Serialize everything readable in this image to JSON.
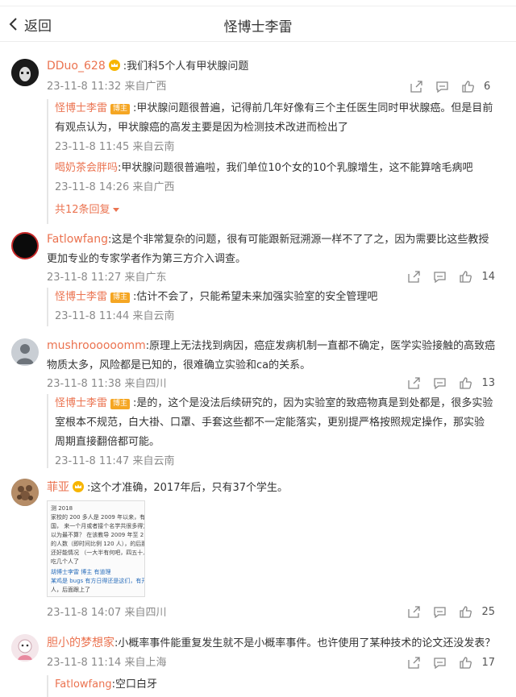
{
  "header": {
    "back_label": "返回",
    "title": "怪博士李雷"
  },
  "comments": [
    {
      "user": "DDuo_628",
      "text": ":我们科5个人有甲状腺问题",
      "meta": "23-11-8 11:32 来自广西",
      "likes": "6",
      "replies": [
        {
          "user": "怪博士李雷",
          "badge": "博主",
          "text": ":甲状腺问题很普遍，记得前几年好像有三个主任医生同时甲状腺癌。但是目前",
          "text2": "有观点认为，甲状腺癌的高发主要是因为检测技术改进而检出了",
          "meta": "23-11-8 11:45 来自云南"
        },
        {
          "user": "喝奶茶会胖吗",
          "text": ":甲状腺问题很普遍啦，我们单位10个女的10个乳腺增生，这不能算啥毛病吧",
          "meta": "23-11-8 14:26 来自广西"
        }
      ],
      "more_replies": "共12条回复"
    },
    {
      "user": "Fatlowfang",
      "text": ":这是个非常复杂的问题，很有可能跟新冠溯源一样不了了之，因为需要比这些教授",
      "text2": "更加专业的专家学者作为第三方介入调查。",
      "meta": "23-11-8 11:27 来自广东",
      "likes": "14",
      "replies": [
        {
          "user": "怪博士李雷",
          "badge": "博主",
          "text": ":估计不会了，只能希望未来加强实验室的安全管理吧",
          "meta": "23-11-8 11:44 来自云南"
        }
      ]
    },
    {
      "user": "mushroooooomm",
      "text": ":原理上无法找到病因，癌症发病机制一直都不确定，医学实验接触的高致癌",
      "text2": "物质太多，风险都是已知的，很难确立实验和ca的关系。",
      "meta": "23-11-8 11:38 来自四川",
      "likes": "13",
      "replies": [
        {
          "user": "怪博士李雷",
          "badge": "博主",
          "text": ":是的，这个是没法后续研究的，因为实验室的致癌物真是到处都是，很多实验",
          "text2": "室根本不规范，白大褂、口罩、手套这些都不一定能落实，更别提严格按照规定操作，那实验",
          "text3": "周期直接翻倍都可能。",
          "meta": "23-11-8 11:47 来自云南"
        }
      ]
    },
    {
      "user": "菲亚",
      "text": ":这个才准确，2017年后，只有37个学生。",
      "image_lines": [
        "测 2018",
        "家校的 200 多人是 2009 年以来，有且仅",
        "国， 来一个月或者接个名学共很多得方不简",
        "以为最不算？ 在该教导 2009 年至 2",
        "的人数（即时间比例 120 人），的后那段",
        "还好能情况 （一大半有何吧，四五十人）",
        "吃几个人了",
        "胡博士李雷 博主 有道理",
        "某鸡是 bugs 有方日得还是这们，有开化以后",
        "人，后面跟上了"
      ],
      "meta": "23-11-8 14:07 来自四川",
      "likes": "25"
    },
    {
      "user": "胆小的梦想家",
      "text": ":小概率事件能重复发生就不是小概率事件。也许使用了某种技术的论文还没发表？",
      "meta": "23-11-8 11:14 来自上海",
      "likes": "17",
      "replies": [
        {
          "user": "Fatlowfang",
          "text": ":空口白牙"
        }
      ]
    }
  ]
}
